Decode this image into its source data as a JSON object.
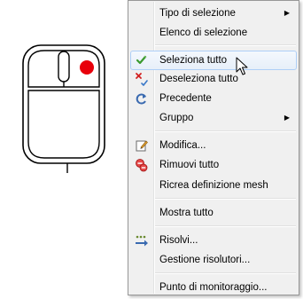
{
  "illustration": {
    "name": "mouse-right-click",
    "button_marker_color": "#e8000b"
  },
  "menu": {
    "items": [
      {
        "label": "Tipo di selezione",
        "has_submenu": true,
        "icon": ""
      },
      {
        "label": "Elenco di selezione",
        "has_submenu": false,
        "icon": ""
      },
      {
        "label": "Seleziona tutto",
        "has_submenu": false,
        "icon": "check-green-icon",
        "highlighted": true
      },
      {
        "label": "Deseleziona tutto",
        "has_submenu": false,
        "icon": "deselect-red-x-icon"
      },
      {
        "label": "Precedente",
        "has_submenu": false,
        "icon": "previous-arrow-icon"
      },
      {
        "label": "Gruppo",
        "has_submenu": true,
        "icon": ""
      },
      {
        "label": "Modifica...",
        "has_submenu": false,
        "icon": "edit-pencil-icon"
      },
      {
        "label": "Rimuovi tutto",
        "has_submenu": false,
        "icon": "remove-all-icon"
      },
      {
        "label": "Ricrea definizione mesh",
        "has_submenu": false,
        "icon": ""
      },
      {
        "label": "Mostra tutto",
        "has_submenu": false,
        "icon": ""
      },
      {
        "label": "Risolvi...",
        "has_submenu": false,
        "icon": "solve-icon"
      },
      {
        "label": "Gestione risolutori...",
        "has_submenu": false,
        "icon": ""
      },
      {
        "label": "Punto di monitoraggio...",
        "has_submenu": false,
        "icon": ""
      }
    ],
    "submenu_arrow": "▶"
  },
  "colors": {
    "highlight_border": "#aecff7",
    "menu_background": "#f0f0f0",
    "menu_border": "#979797"
  }
}
